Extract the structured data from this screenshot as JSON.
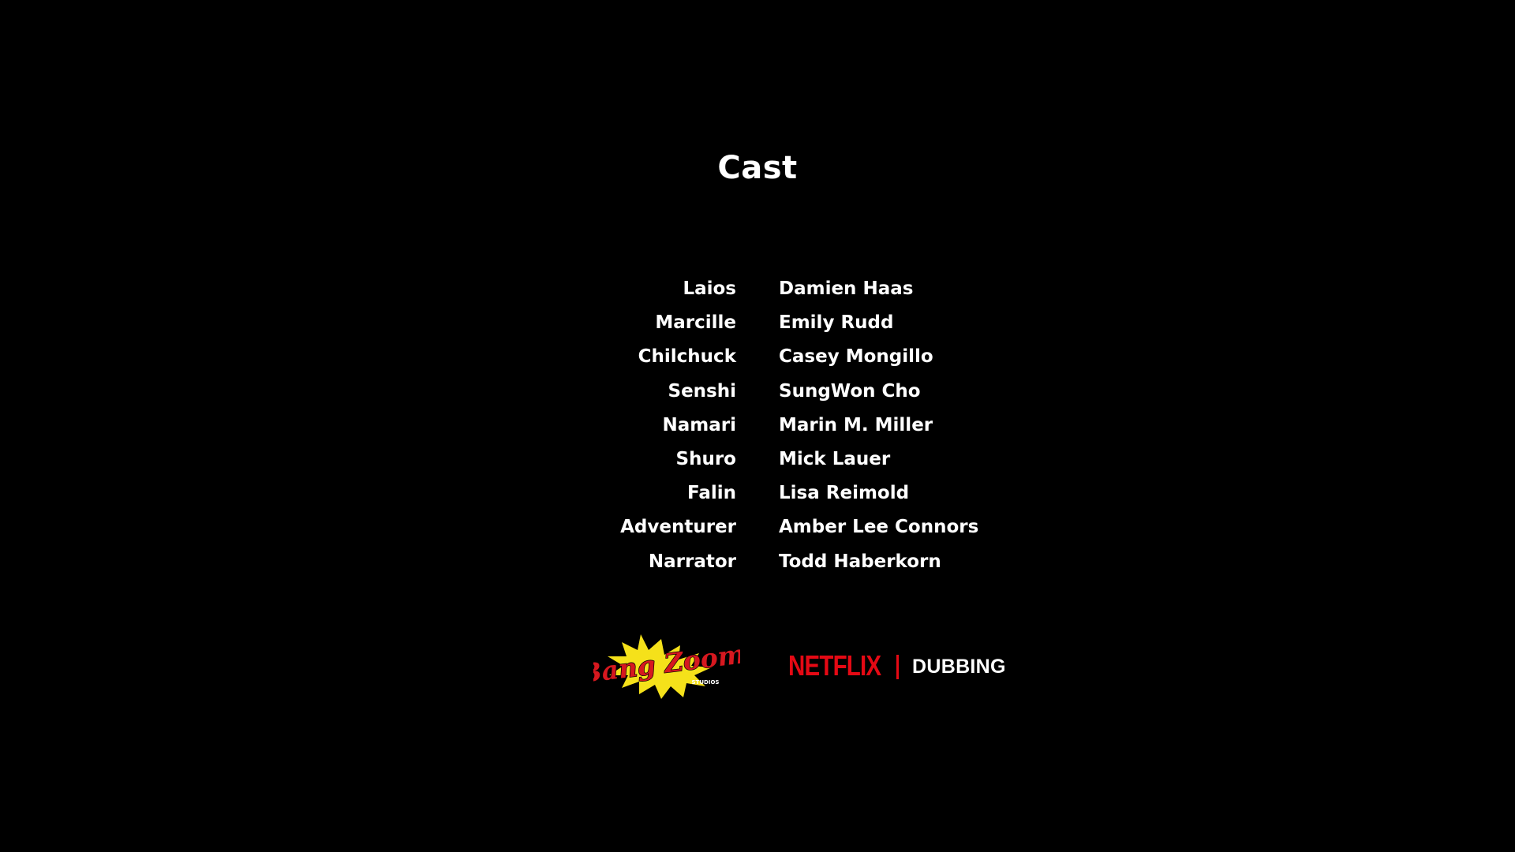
{
  "title": "Cast",
  "cast": [
    {
      "role": "Laios",
      "actor": "Damien Haas"
    },
    {
      "role": "Marcille",
      "actor": "Emily Rudd"
    },
    {
      "role": "Chilchuck",
      "actor": "Casey Mongillo"
    },
    {
      "role": "Senshi",
      "actor": "SungWon Cho"
    },
    {
      "role": "Namari",
      "actor": "Marin M. Miller"
    },
    {
      "role": "Shuro",
      "actor": "Mick Lauer"
    },
    {
      "role": "Falin",
      "actor": "Lisa Reimold"
    },
    {
      "role": "Adventurer",
      "actor": "Amber Lee Connors"
    },
    {
      "role": "Narrator",
      "actor": "Todd Haberkorn"
    }
  ],
  "logos": {
    "bangzoom": {
      "text": "Bang Zoom!",
      "subtext": "STUDIOS",
      "burst_color": "#f5e11a",
      "text_color": "#d6181f"
    },
    "netflix": "NETFLIX",
    "dubbing": "DUBBING",
    "netflix_color": "#e50914"
  },
  "colors": {
    "background": "#000000",
    "text": "#ffffff"
  }
}
